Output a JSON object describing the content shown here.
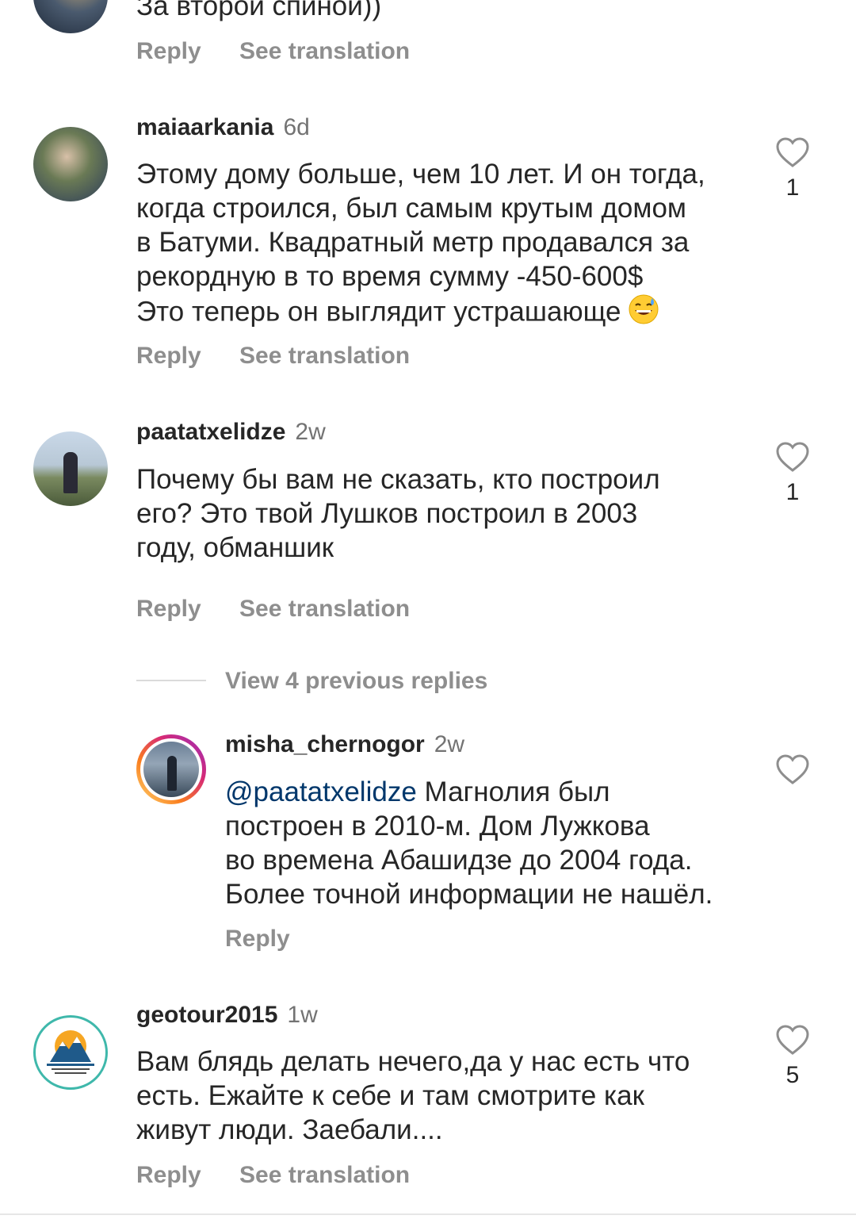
{
  "comments": [
    {
      "text_lines": [
        "За второй спиной))"
      ],
      "actions": {
        "reply": "Reply",
        "translate": "See translation"
      }
    },
    {
      "username": "maiaarkania",
      "time": "6d",
      "text_lines": [
        "Этому дому больше, чем 10 лет. И он тогда,",
        "когда строился, был самым крутым домом",
        "в Батуми. Квадратный метр продавался за",
        "рекордную в то время сумму -450-600$",
        "Это теперь он выглядит устрашающе"
      ],
      "emoji": "grinning-sweat-emoji",
      "likes": "1",
      "actions": {
        "reply": "Reply",
        "translate": "See translation"
      }
    },
    {
      "username": "paatatxelidze",
      "time": "2w",
      "text_lines": [
        "Почему бы вам не сказать, кто построил",
        "его?  Это твой Лушков построил в 2003",
        "году, обманшик"
      ],
      "likes": "1",
      "actions": {
        "reply": "Reply",
        "translate": "See translation"
      }
    },
    {
      "username": "geotour2015",
      "time": "1w",
      "text_lines": [
        "Вам блядь делать нечего,да у нас есть что",
        "есть. Ежайте к себе и там смотрите как",
        "живут люди. Заебали...."
      ],
      "likes": "5",
      "actions": {
        "reply": "Reply",
        "translate": "See translation"
      }
    }
  ],
  "replies": {
    "view_previous": "View 4 previous replies",
    "reply": {
      "username": "misha_chernogor",
      "time": "2w",
      "mention": "@paatatxelidze",
      "text_first": " Магнолия был",
      "text_lines": [
        "построен в 2010-м. Дом Лужкова",
        "во времена Абашидзе до 2004 года.",
        "Более точной информации не нашёл."
      ],
      "actions": {
        "reply": "Reply"
      }
    }
  },
  "colors": {
    "text": "#262626",
    "secondary": "#8e8e8e",
    "mention": "#00376b",
    "story_ring_start": "#feda75",
    "story_ring_end": "#d62976"
  }
}
